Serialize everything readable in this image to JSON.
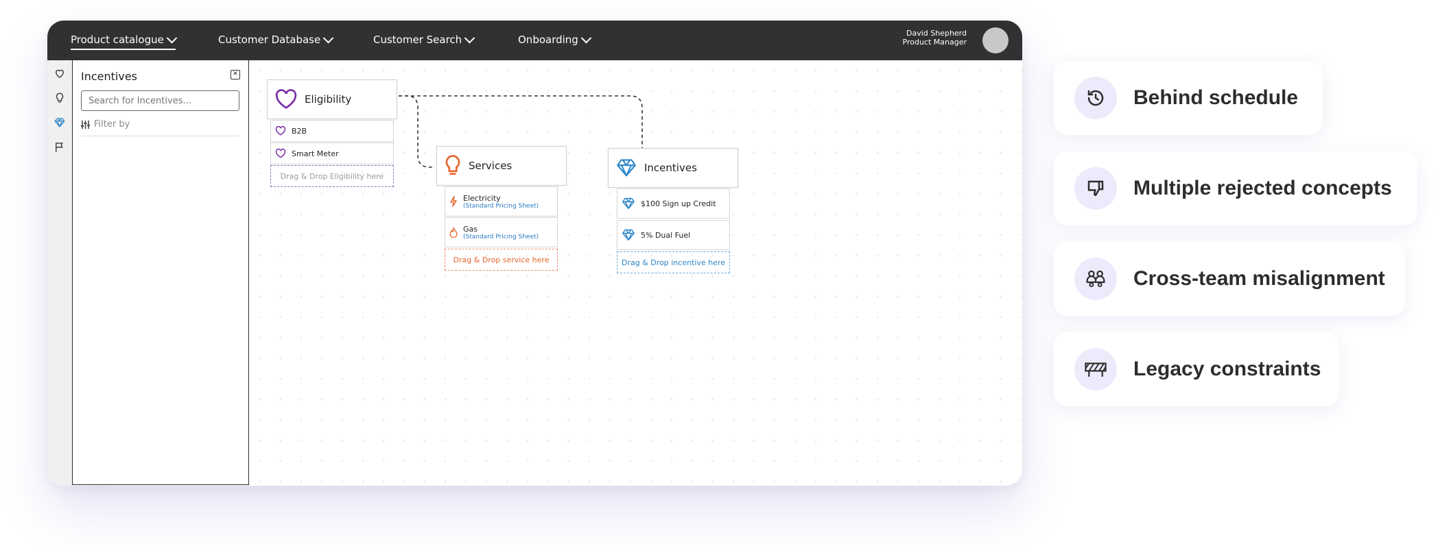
{
  "topbar": {
    "nav": [
      {
        "label": "Product catalogue"
      },
      {
        "label": "Customer Database"
      },
      {
        "label": "Customer Search"
      },
      {
        "label": "Onboarding"
      }
    ],
    "user": {
      "name": "David Shepherd",
      "role": "Product Manager"
    }
  },
  "sidebar_icons": [
    "heart-icon",
    "lightbulb-icon",
    "diamond-icon",
    "flag-icon"
  ],
  "panel": {
    "title": "Incentives",
    "search_placeholder": "Search for Incentives...",
    "filter_label": "Filter by"
  },
  "canvas": {
    "eligibility": {
      "title": "Eligibility",
      "items": [
        "B2B",
        "Smart Meter"
      ],
      "drop_label": "Drag & Drop Eligibility here",
      "color": "#7b2fa8"
    },
    "services": {
      "title": "Services",
      "items": [
        {
          "name": "Electricity",
          "sub": "(Standard Pricing Sheet)"
        },
        {
          "name": "Gas",
          "sub": "(Standard Pricing Sheet)"
        }
      ],
      "drop_label": "Drag & Drop service here",
      "color": "#e8642c"
    },
    "incentives": {
      "title": "Incentives",
      "items": [
        "$100 Sign up Credit",
        "5% Dual Fuel"
      ],
      "drop_label": "Drag & Drop incentive here",
      "color": "#2a86c8"
    }
  },
  "issues": [
    {
      "label": "Behind schedule",
      "icon": "history-icon"
    },
    {
      "label": "Multiple rejected concepts",
      "icon": "thumbs-down-icon"
    },
    {
      "label": "Cross-team misalignment",
      "icon": "team-icon"
    },
    {
      "label": "Legacy constraints",
      "icon": "barrier-icon"
    }
  ],
  "colors": {
    "topbar": "#2f3133",
    "icon_bg": "#ecebfb",
    "accent": "#5b4fc8"
  }
}
